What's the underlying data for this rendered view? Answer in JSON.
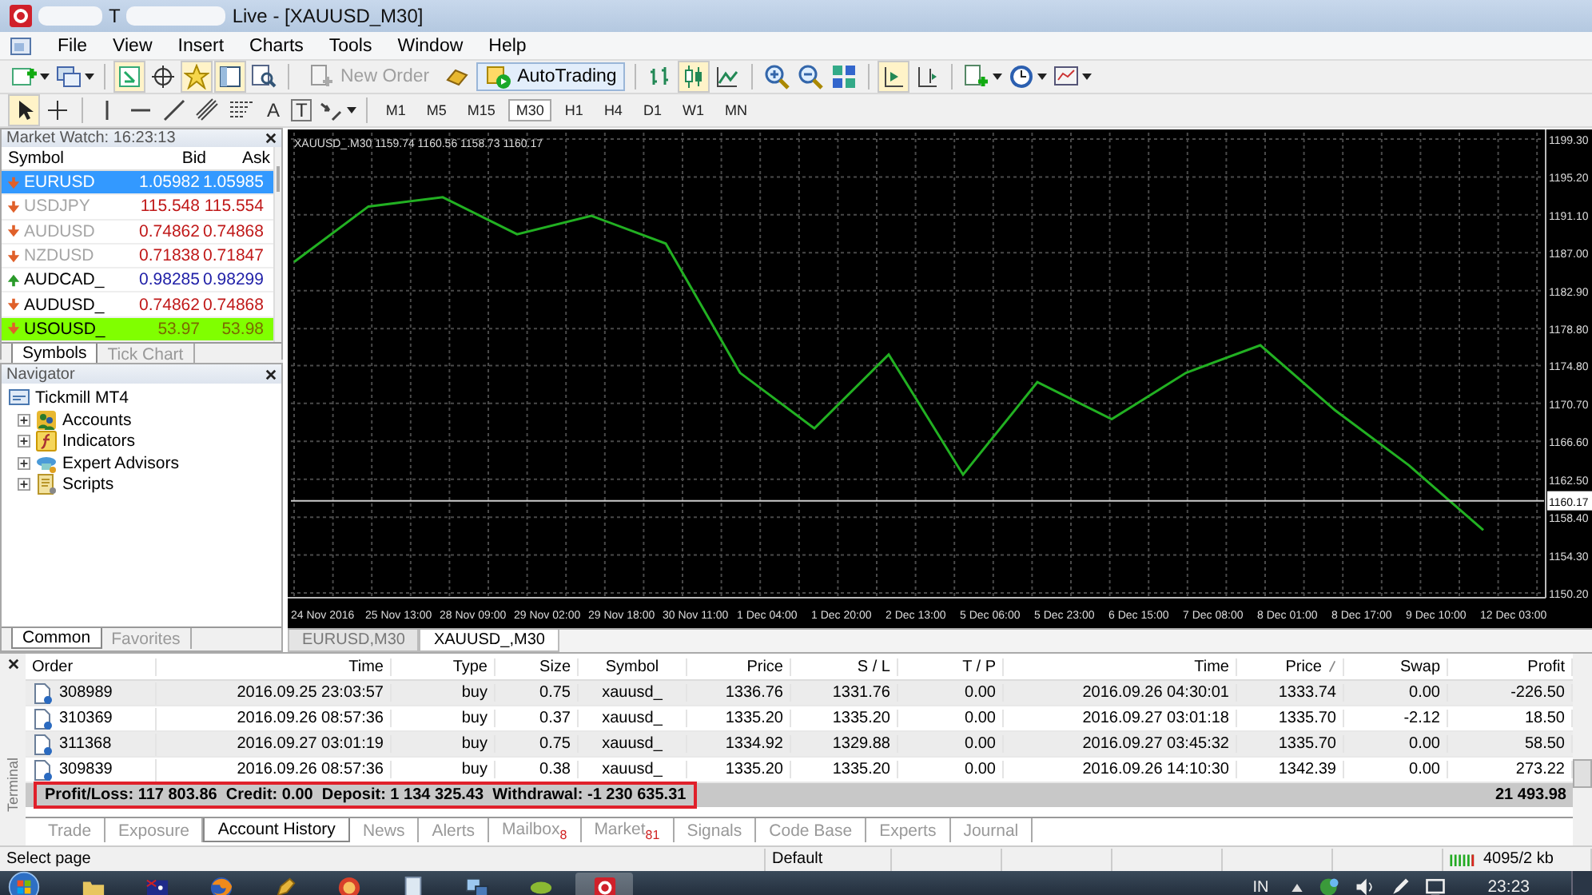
{
  "window": {
    "title_start": "T",
    "title_end": "Live - [XAUUSD_M30]"
  },
  "menu": [
    "File",
    "View",
    "Insert",
    "Charts",
    "Tools",
    "Window",
    "Help"
  ],
  "toolbar": {
    "new_order": {
      "label": "New Order",
      "disabled": true
    },
    "autotrading": {
      "label": "AutoTrading",
      "on": true
    }
  },
  "drawing_tools": {
    "text_label": "A",
    "text_box_label": "T"
  },
  "timeframes": [
    {
      "label": "M1",
      "selected": false
    },
    {
      "label": "M5",
      "selected": false
    },
    {
      "label": "M15",
      "selected": false
    },
    {
      "label": "M30",
      "selected": true
    },
    {
      "label": "H1",
      "selected": false
    },
    {
      "label": "H4",
      "selected": false
    },
    {
      "label": "D1",
      "selected": false
    },
    {
      "label": "W1",
      "selected": false
    },
    {
      "label": "MN",
      "selected": false
    }
  ],
  "market_watch": {
    "title": "Market Watch: 16:23:13",
    "columns": [
      "Symbol",
      "Bid",
      "Ask"
    ],
    "rows": [
      {
        "symbol": "EURUSD",
        "bid": "1.05982",
        "ask": "1.05985",
        "rising": false,
        "dimmed": false,
        "selected": true,
        "highlighted": false
      },
      {
        "symbol": "USDJPY",
        "bid": "115.548",
        "ask": "115.554",
        "rising": false,
        "dimmed": true,
        "selected": false,
        "highlighted": false
      },
      {
        "symbol": "AUDUSD",
        "bid": "0.74862",
        "ask": "0.74868",
        "rising": false,
        "dimmed": true,
        "selected": false,
        "highlighted": false
      },
      {
        "symbol": "NZDUSD",
        "bid": "0.71838",
        "ask": "0.71847",
        "rising": false,
        "dimmed": true,
        "selected": false,
        "highlighted": false
      },
      {
        "symbol": "AUDCAD_",
        "bid": "0.98285",
        "ask": "0.98299",
        "rising": true,
        "dimmed": false,
        "selected": false,
        "highlighted": false
      },
      {
        "symbol": "AUDUSD_",
        "bid": "0.74862",
        "ask": "0.74868",
        "rising": false,
        "dimmed": false,
        "selected": false,
        "highlighted": false
      },
      {
        "symbol": "USOUSD_",
        "bid": "53.97",
        "ask": "53.98",
        "rising": false,
        "dimmed": false,
        "selected": false,
        "highlighted": true
      }
    ],
    "tabs": [
      {
        "label": "Symbols",
        "selected": true
      },
      {
        "label": "Tick Chart",
        "selected": false
      }
    ]
  },
  "navigator": {
    "title": "Navigator",
    "root": "Tickmill MT4",
    "children": [
      {
        "label": "Accounts",
        "kind": "accounts",
        "expanded": false
      },
      {
        "label": "Indicators",
        "kind": "indicators",
        "expanded": false
      },
      {
        "label": "Expert Advisors",
        "kind": "experts",
        "expanded": false
      },
      {
        "label": "Scripts",
        "kind": "scripts",
        "expanded": false
      }
    ],
    "tabs": [
      {
        "label": "Common",
        "selected": true
      },
      {
        "label": "Favorites",
        "selected": false
      }
    ]
  },
  "chart": {
    "header": "1159.74 1160.56 1158.73 1160.17",
    "tabs": [
      {
        "label": "EURUSD,M30",
        "selected": false
      },
      {
        "label": "XAUUSD_,M30",
        "selected": true
      }
    ],
    "chart_data": {
      "type": "line",
      "categories": [
        "24 Nov 2016",
        "25 Nov 13:00",
        "28 Nov 09:00",
        "29 Nov 02:00",
        "29 Nov 18:00",
        "30 Nov 11:00",
        "1 Dec 04:00",
        "1 Dec 20:00",
        "2 Dec 13:00",
        "5 Dec 06:00",
        "5 Dec 23:00",
        "6 Dec 15:00",
        "7 Dec 08:00",
        "8 Dec 01:00",
        "8 Dec 17:00",
        "9 Dec 10:00",
        "12 Dec 03:00"
      ],
      "series": [
        {
          "name": "XAUUSD_.M30",
          "color": "#22b022",
          "values": [
            1186,
            1192,
            1193,
            1189,
            1191,
            1188,
            1174,
            1168,
            1176,
            1163,
            1173,
            1169,
            1174,
            1177,
            1170,
            1164,
            1157
          ]
        }
      ],
      "ylim": [
        1150.2,
        1199.3
      ],
      "yticks": [
        {
          "value": 1199.3,
          "label": "1199.30"
        },
        {
          "value": 1195.2,
          "label": "1195.20"
        },
        {
          "value": 1191.1,
          "label": "1191.10"
        },
        {
          "value": 1187,
          "label": "1187.00"
        },
        {
          "value": 1182.9,
          "label": "1182.90"
        },
        {
          "value": 1178.8,
          "label": "1178.80"
        },
        {
          "value": 1174.8,
          "label": "1174.80"
        },
        {
          "value": 1170.7,
          "label": "1170.70"
        },
        {
          "value": 1166.6,
          "label": "1166.60"
        },
        {
          "value": 1162.5,
          "label": "1162.50"
        },
        {
          "value": 1158.4,
          "label": "1158.40"
        },
        {
          "value": 1154.3,
          "label": "1154.30"
        },
        {
          "value": 1150.2,
          "label": "1150.20"
        }
      ],
      "grid": true,
      "ref_lines": [
        {
          "axis": "y",
          "value": 1160.17,
          "label": "1160.17"
        }
      ]
    }
  },
  "terminal": {
    "title": "Terminal",
    "columns": [
      {
        "label": "Order",
        "sorted": false
      },
      {
        "label": "Time",
        "sorted": false
      },
      {
        "label": "Type",
        "sorted": false
      },
      {
        "label": "Size",
        "sorted": false
      },
      {
        "label": "Symbol",
        "sorted": false
      },
      {
        "label": "Price",
        "sorted": false
      },
      {
        "label": "S / L",
        "sorted": false
      },
      {
        "label": "T / P",
        "sorted": false
      },
      {
        "label": "Time",
        "sorted": false
      },
      {
        "label": "Price",
        "sorted": true
      },
      {
        "label": "Swap",
        "sorted": false
      },
      {
        "label": "Profit",
        "sorted": false
      }
    ],
    "rows": [
      [
        "308989",
        "2016.09.25 23:03:57",
        "buy",
        "0.75",
        "xauusd_",
        "1336.76",
        "1331.76",
        "0.00",
        "2016.09.26 04:30:01",
        "1333.74",
        "0.00",
        "-226.50"
      ],
      [
        "310369",
        "2016.09.26 08:57:36",
        "buy",
        "0.37",
        "xauusd_",
        "1335.20",
        "1335.20",
        "0.00",
        "2016.09.27 03:01:18",
        "1335.70",
        "-2.12",
        "18.50"
      ],
      [
        "311368",
        "2016.09.27 03:01:19",
        "buy",
        "0.75",
        "xauusd_",
        "1334.92",
        "1329.88",
        "0.00",
        "2016.09.27 03:45:32",
        "1335.70",
        "0.00",
        "58.50"
      ],
      [
        "309839",
        "2016.09.26 08:57:36",
        "buy",
        "0.38",
        "xauusd_",
        "1335.20",
        "1335.20",
        "0.00",
        "2016.09.26 14:10:30",
        "1342.39",
        "0.00",
        "273.22"
      ]
    ],
    "summary": {
      "text": "Profit/Loss: 117 803.86  Credit: 0.00  Deposit: 1 134 325.43  Withdrawal: -1 230 635.31",
      "total": "21 493.98",
      "highlighted": true
    },
    "tabs": [
      {
        "label": "Trade",
        "selected": false
      },
      {
        "label": "Exposure",
        "selected": false
      },
      {
        "label": "Account History",
        "selected": true
      },
      {
        "label": "News",
        "selected": false
      },
      {
        "label": "Alerts",
        "selected": false
      },
      {
        "label": "Mailbox",
        "selected": false,
        "badge": "8"
      },
      {
        "label": "Market",
        "selected": false,
        "badge": "81"
      },
      {
        "label": "Signals",
        "selected": false
      },
      {
        "label": "Code Base",
        "selected": false
      },
      {
        "label": "Experts",
        "selected": false
      },
      {
        "label": "Journal",
        "selected": false
      }
    ]
  },
  "status_bar": {
    "hint": "Select page",
    "profile": "Default",
    "traffic": "4095/2 kb"
  },
  "taskbar": {
    "language": "IN",
    "time": "23:23"
  }
}
